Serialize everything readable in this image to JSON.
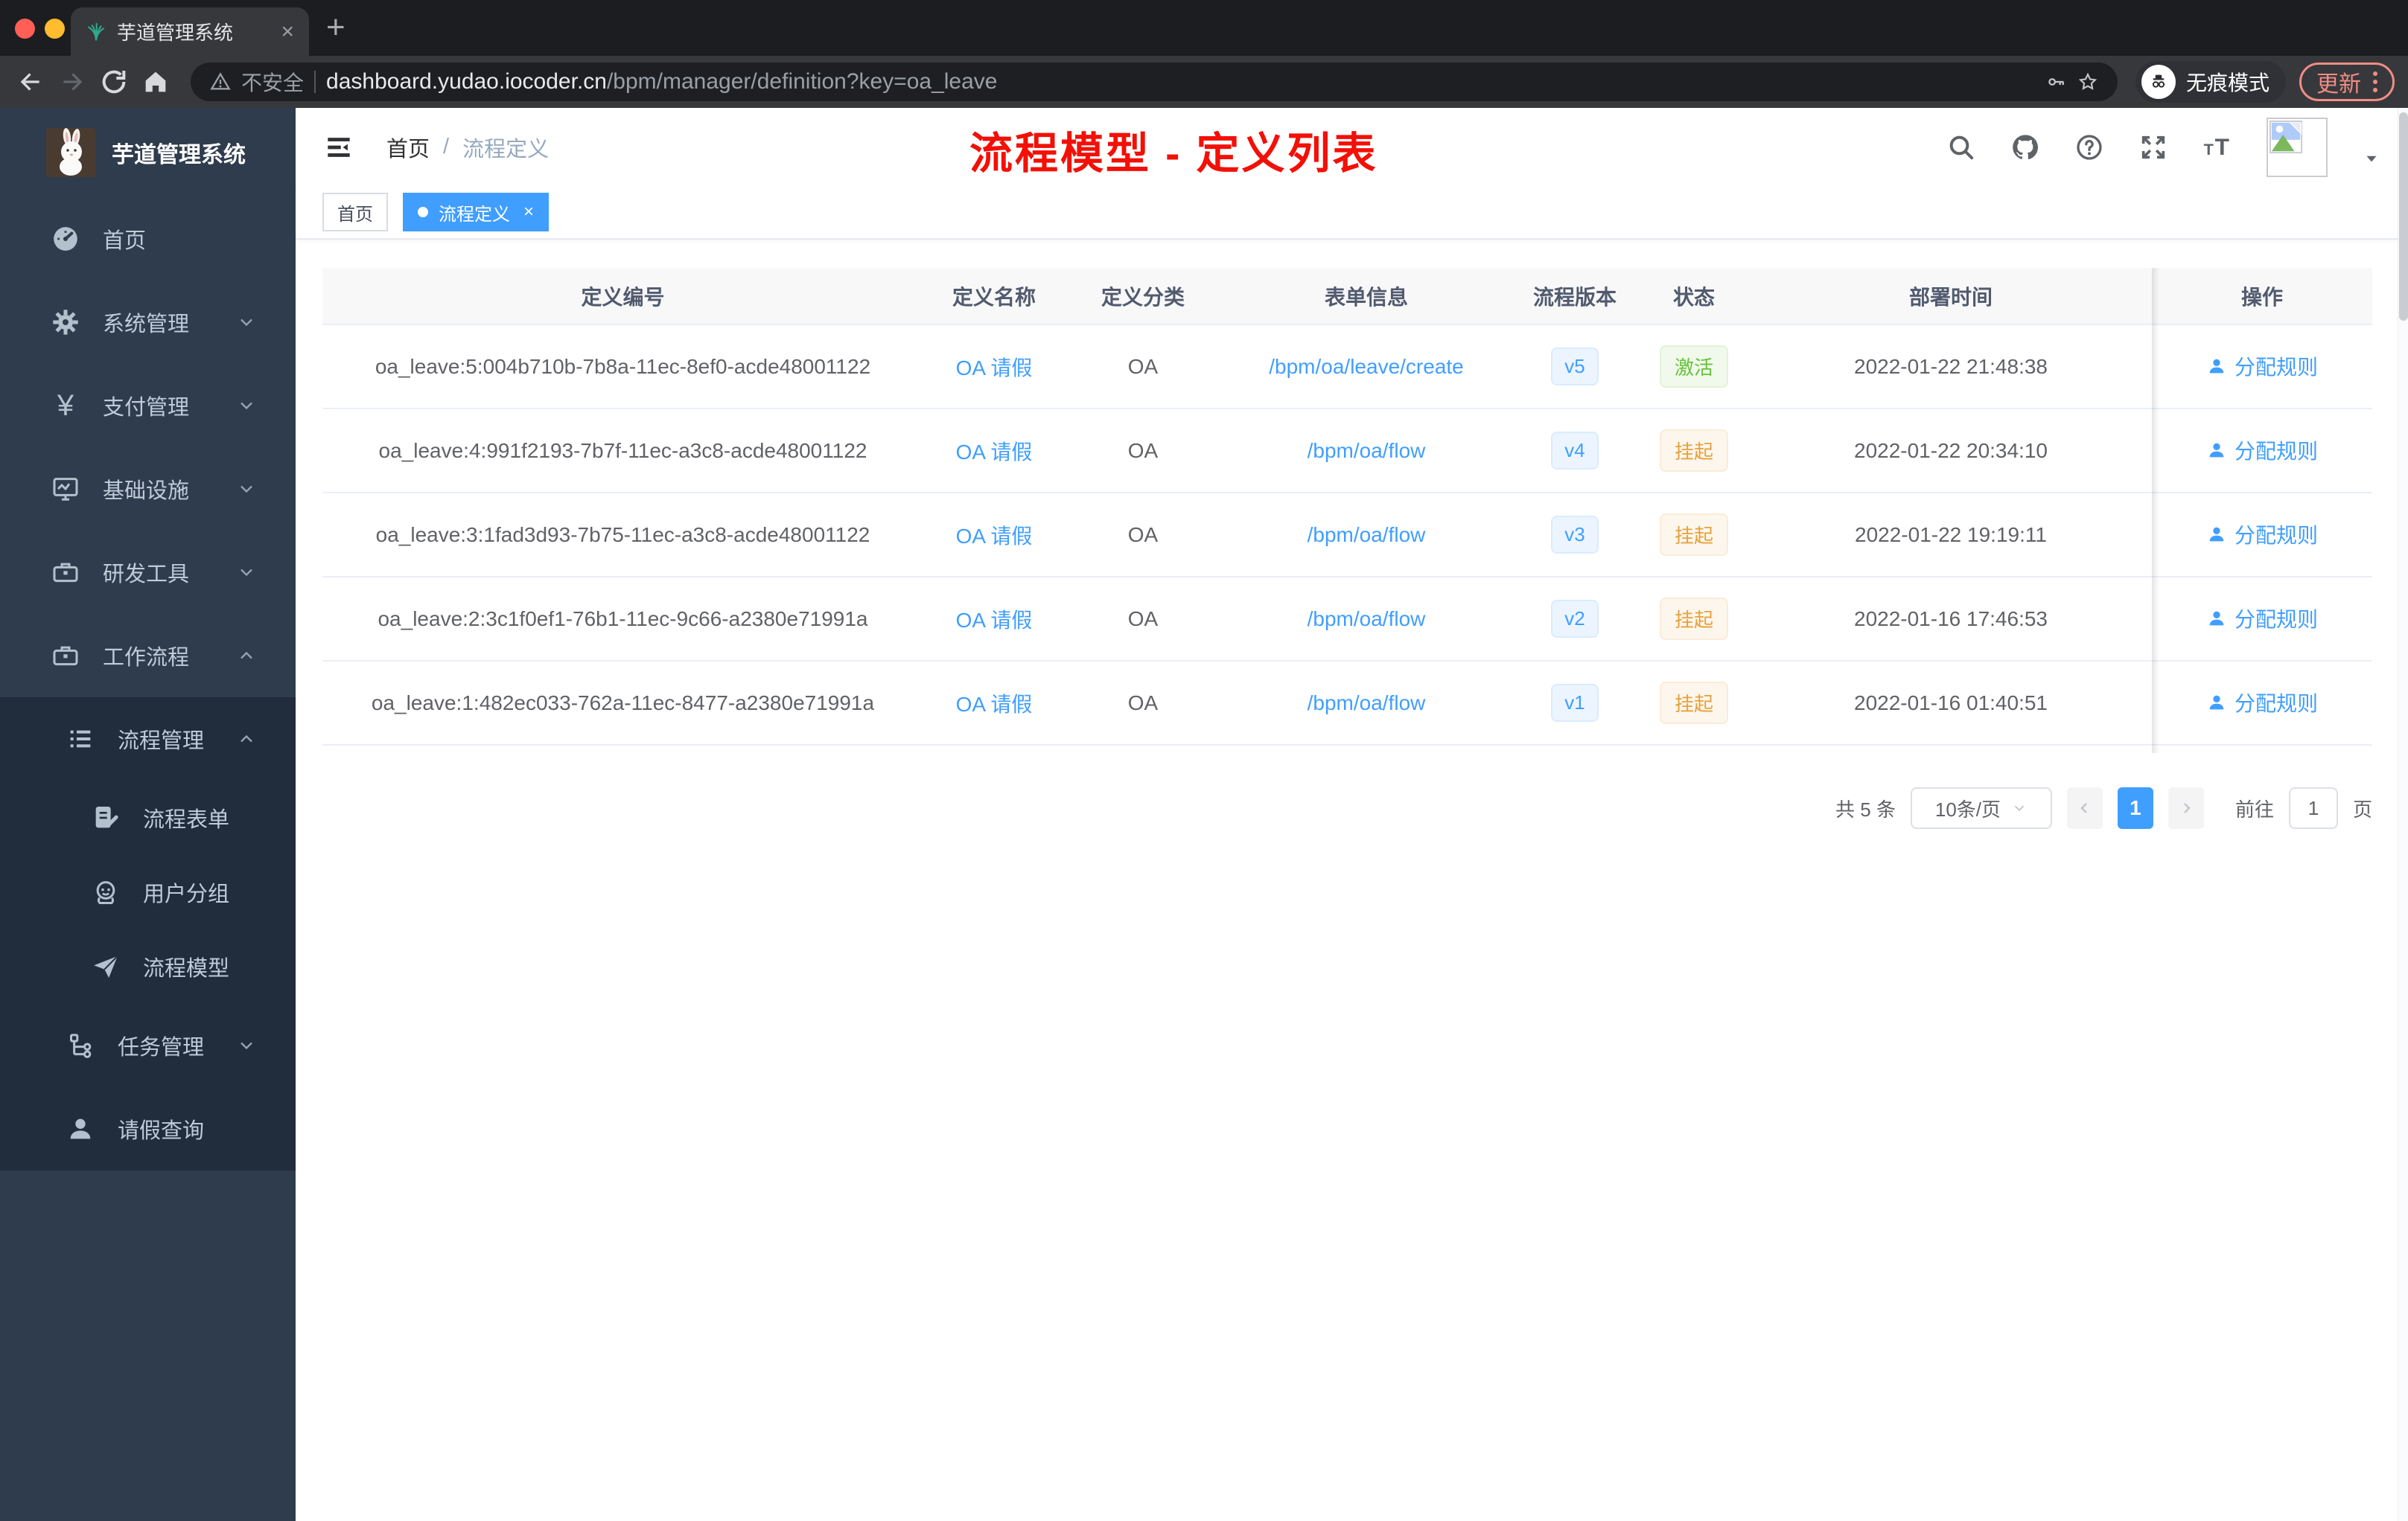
{
  "browser": {
    "tab_title": "芋道管理系统",
    "close_tab": "×",
    "new_tab": "+",
    "not_secure": "不安全",
    "url_host": "dashboard.yudao.iocoder.cn",
    "url_path": "/bpm/manager/definition?key=oa_leave",
    "incognito_label": "无痕模式",
    "update_label": "更新"
  },
  "sidebar": {
    "logo_title": "芋道管理系统",
    "items": [
      {
        "label": "首页"
      },
      {
        "label": "系统管理"
      },
      {
        "label": "支付管理"
      },
      {
        "label": "基础设施"
      },
      {
        "label": "研发工具"
      },
      {
        "label": "工作流程"
      },
      {
        "label": "流程管理"
      },
      {
        "label": "流程表单"
      },
      {
        "label": "用户分组"
      },
      {
        "label": "流程模型"
      },
      {
        "label": "任务管理"
      },
      {
        "label": "请假查询"
      }
    ]
  },
  "header": {
    "breadcrumb_home": "首页",
    "breadcrumb_sep": "/",
    "breadcrumb_current": "流程定义",
    "annotation": "流程模型 - 定义列表"
  },
  "tags": {
    "home": "首页",
    "active": "流程定义",
    "active_close": "×"
  },
  "table": {
    "columns": [
      "定义编号",
      "定义名称",
      "定义分类",
      "表单信息",
      "流程版本",
      "状态",
      "部署时间",
      "操作"
    ],
    "action_label": "分配规则",
    "rows": [
      {
        "id": "oa_leave:5:004b710b-7b8a-11ec-8ef0-acde48001122",
        "name": "OA 请假",
        "category": "OA",
        "form": "/bpm/oa/leave/create",
        "version": "v5",
        "status": "激活",
        "status_type": "success",
        "deploy_time": "2022-01-22 21:48:38"
      },
      {
        "id": "oa_leave:4:991f2193-7b7f-11ec-a3c8-acde48001122",
        "name": "OA 请假",
        "category": "OA",
        "form": "/bpm/oa/flow",
        "version": "v4",
        "status": "挂起",
        "status_type": "warning",
        "deploy_time": "2022-01-22 20:34:10"
      },
      {
        "id": "oa_leave:3:1fad3d93-7b75-11ec-a3c8-acde48001122",
        "name": "OA 请假",
        "category": "OA",
        "form": "/bpm/oa/flow",
        "version": "v3",
        "status": "挂起",
        "status_type": "warning",
        "deploy_time": "2022-01-22 19:19:11"
      },
      {
        "id": "oa_leave:2:3c1f0ef1-76b1-11ec-9c66-a2380e71991a",
        "name": "OA 请假",
        "category": "OA",
        "form": "/bpm/oa/flow",
        "version": "v2",
        "status": "挂起",
        "status_type": "warning",
        "deploy_time": "2022-01-16 17:46:53"
      },
      {
        "id": "oa_leave:1:482ec033-762a-11ec-8477-a2380e71991a",
        "name": "OA 请假",
        "category": "OA",
        "form": "/bpm/oa/flow",
        "version": "v1",
        "status": "挂起",
        "status_type": "warning",
        "deploy_time": "2022-01-16 01:40:51"
      }
    ]
  },
  "pagination": {
    "total": "共 5 条",
    "page_size": "10条/页",
    "page": "1",
    "goto_label": "前往",
    "page_value": "1",
    "unit": "页"
  },
  "colors": {
    "accent": "#409eff",
    "annotation_red": "#f21007",
    "status_active": "#67c23a",
    "status_suspended": "#e6a23c",
    "sidebar_bg": "#2f3c4d",
    "submenu_bg": "#212c3c",
    "version_tag_bg": "#ecf5ff",
    "active_tag_bg": "#409eff"
  }
}
